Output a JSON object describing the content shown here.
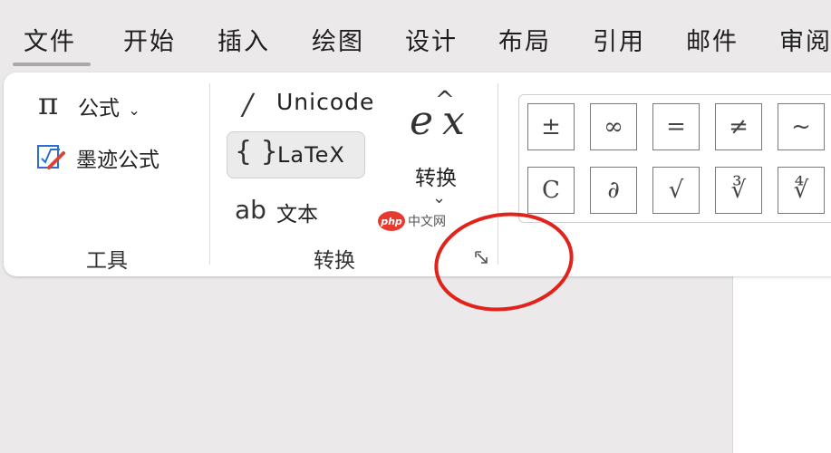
{
  "menu": {
    "items": [
      "文件",
      "开始",
      "插入",
      "绘图",
      "设计",
      "布局",
      "引用",
      "邮件",
      "审阅"
    ]
  },
  "tools_group": {
    "formula_label": "公式",
    "ink_formula_label": "墨迹公式",
    "group_label": "工具"
  },
  "convert_group": {
    "unicode_label": "Unicode",
    "latex_label": "LaTeX",
    "text_label": "文本",
    "text_icon": "ab",
    "convert_label": "转换",
    "group_label": "转换",
    "selected_format": "LaTeX"
  },
  "symbols": {
    "row1": [
      "±",
      "∞",
      "=",
      "≠",
      "~"
    ],
    "row2": [
      "C",
      "∂",
      "√",
      "∛",
      "∜"
    ]
  },
  "watermark": {
    "badge": "php",
    "text": "中文网"
  },
  "colors": {
    "annotation_circle": "#e0241c",
    "accent_red": "#d4453c",
    "accent_blue": "#2b6fd6"
  }
}
